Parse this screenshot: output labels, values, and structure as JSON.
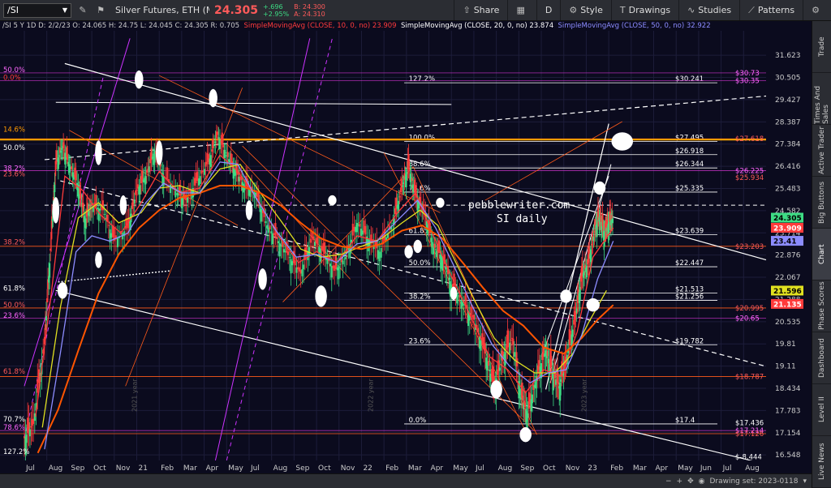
{
  "toolbar": {
    "symbol": "/SI",
    "instrument": "Silver Futures, ETH (MAR 23)",
    "last": "24.305",
    "change": "+.696",
    "change_pct": "+2.95%",
    "bid": "B: 24.300",
    "ask": "A: 24.310",
    "share": "Share",
    "period": "D",
    "style": "Style",
    "drawings": "Drawings",
    "studies": "Studies",
    "patterns": "Patterns"
  },
  "study_line": {
    "header": "/SI 5 Y 1D  D: 2/2/23  O: 24.065  H: 24.75  L: 24.045  C: 24.305  R: 0.705",
    "sma10": "SimpleMovingAvg (CLOSE, 10, 0, no)",
    "sma10_val": "23.909",
    "sma20": "SimpleMovingAvg (CLOSE, 20, 0, no)",
    "sma20_val": "23.874",
    "sma50": "SimpleMovingAvg (CLOSE, 50, 0, no)",
    "sma50_val": "32.922"
  },
  "side_tabs": [
    "Trade",
    "Times And Sales",
    "Active Trader",
    "Big Buttons",
    "Chart",
    "Phase Scores",
    "Dashboard",
    "Level II",
    "Live News"
  ],
  "bottom_bar": {
    "drawing_set": "Drawing set: 2023-0118"
  },
  "colors": {
    "background": "#0b0b1e",
    "price_up": "#3ddc84",
    "price_down": "#ff3b3b",
    "sma10": "#ff3b3b",
    "sma20": "#ffffff",
    "sma50": "#8c8cff",
    "sma_slow": "#ff5500",
    "sma_yellow": "#e0e020",
    "fib": "#ff9900",
    "annotation": "#ffffff"
  },
  "chart_data": {
    "type": "candlestick",
    "y_ticks": [
      "31.623",
      "30.505",
      "29.427",
      "28.387",
      "27.384",
      "26.416",
      "25.483",
      "24.582",
      "23.714",
      "22.876",
      "22.067",
      "21.288",
      "20.535",
      "19.81",
      "19.11",
      "18.434",
      "17.783",
      "17.154",
      "16.548"
    ],
    "y_range": [
      16.4,
      32.9
    ],
    "y_scale": "log",
    "x_labels": [
      "Jul",
      "Aug",
      "Sep",
      "Oct",
      "Nov",
      "21",
      "Feb",
      "Mar",
      "Apr",
      "May",
      "Jul",
      "Aug",
      "Sep",
      "Oct",
      "Nov",
      "22",
      "Feb",
      "Mar",
      "Apr",
      "May",
      "Jul",
      "Aug",
      "Sep",
      "Oct",
      "Nov",
      "23",
      "Feb",
      "Mar",
      "Apr",
      "May",
      "Jun",
      "Jul",
      "Aug"
    ],
    "year_markers": [
      "2021 year",
      "2022 year",
      "2023 year"
    ],
    "right_price_labels": [
      {
        "text": "$30.73",
        "price": 30.73,
        "color": "#ff66ff"
      },
      {
        "text": "$30.35",
        "price": 30.35,
        "color": "#ff66ff"
      },
      {
        "text": "$27.618",
        "price": 27.618,
        "color": "#ff5a5a"
      },
      {
        "text": "$26.225",
        "price": 26.225,
        "color": "#ff66ff"
      },
      {
        "text": "$25.934",
        "price": 25.934,
        "color": "#ff5a5a"
      },
      {
        "text": "$23.203",
        "price": 23.203,
        "color": "#ff5a5a"
      },
      {
        "text": "$20.995",
        "price": 20.995,
        "color": "#ff5a5a"
      },
      {
        "text": "$20.65",
        "price": 20.65,
        "color": "#ff66ff"
      },
      {
        "text": "$18.787",
        "price": 18.787,
        "color": "#ff5a5a"
      },
      {
        "text": "$17.436",
        "price": 17.436,
        "color": "#ffffff"
      },
      {
        "text": "$17.214",
        "price": 17.214,
        "color": "#ff66ff"
      },
      {
        "text": "$17.126",
        "price": 17.126,
        "color": "#ff5a5a"
      },
      {
        "text": "$-8.444",
        "price": 16.5,
        "color": "#ffffff"
      }
    ],
    "price_badges": [
      {
        "text": "24.305",
        "price": 24.305,
        "bg": "#3ddc84",
        "fg": "#000"
      },
      {
        "text": "23.909",
        "price": 23.909,
        "bg": "#ff3b3b",
        "fg": "#fff"
      },
      {
        "text": "23.41",
        "price": 23.41,
        "bg": "#8c8cff",
        "fg": "#000"
      },
      {
        "text": "21.596",
        "price": 21.596,
        "bg": "#e0e020",
        "fg": "#000"
      },
      {
        "text": "21.135",
        "price": 21.135,
        "bg": "#ff3b3b",
        "fg": "#fff"
      }
    ],
    "left_fib_labels": [
      {
        "text": "50.0%",
        "price": 30.73,
        "color": "#ff66ff"
      },
      {
        "text": "0.0%",
        "price": 30.35,
        "color": "#ff3b3b"
      },
      {
        "text": "14.6%",
        "price": 27.9,
        "color": "#ff9900"
      },
      {
        "text": "50.0%",
        "price": 27.08,
        "color": "#ffffff"
      },
      {
        "text": "38.2%",
        "price": 26.2,
        "color": "#ff66ff"
      },
      {
        "text": "23.6%",
        "price": 25.95,
        "color": "#ff5a5a"
      },
      {
        "text": "38.2%",
        "price": 23.25,
        "color": "#ff5a5a"
      },
      {
        "text": "61.8%",
        "price": 21.56,
        "color": "#ffffff"
      },
      {
        "text": "50.0%",
        "price": 21.0,
        "color": "#ff5a5a"
      },
      {
        "text": "23.6%",
        "price": 20.64,
        "color": "#ff66ff"
      },
      {
        "text": "61.8%",
        "price": 18.85,
        "color": "#ff5a5a"
      },
      {
        "text": "70.7%",
        "price": 17.45,
        "color": "#ffffff"
      },
      {
        "text": "78.6%",
        "price": 17.22,
        "color": "#ff66ff"
      },
      {
        "text": "127.2%",
        "price": 16.55,
        "color": "#ffffff"
      }
    ],
    "fib_levels": [
      {
        "pct": "127.2%",
        "value": "$30.241",
        "price": 30.241
      },
      {
        "pct": "100.0%",
        "value": "$27.495",
        "price": 27.495
      },
      {
        "pct": "",
        "value": "$26.918",
        "price": 26.918
      },
      {
        "pct": "88.6%",
        "value": "$26.344",
        "price": 26.344
      },
      {
        "pct": "78.6%",
        "value": "$25.335",
        "price": 25.335
      },
      {
        "pct": "61.8%",
        "value": "$23.639",
        "price": 23.639
      },
      {
        "pct": "50.0%",
        "value": "$22.447",
        "price": 22.447
      },
      {
        "pct": "",
        "value": "$21.513",
        "price": 21.513
      },
      {
        "pct": "38.2%",
        "value": "$21.256",
        "price": 21.256
      },
      {
        "pct": "23.6%",
        "value": "$19.782",
        "price": 19.782
      },
      {
        "pct": "0.0%",
        "value": "$17.4",
        "price": 17.4
      }
    ],
    "annotations": [
      "pebblewriter.com",
      "SI daily"
    ],
    "series": [
      {
        "name": "close",
        "color": "#3ddc84",
        "points": [
          [
            0,
            17.0
          ],
          [
            0.4,
            17.4
          ],
          [
            0.9,
            19.8
          ],
          [
            1.2,
            23.5
          ],
          [
            1.4,
            26.5
          ],
          [
            1.7,
            27.3
          ],
          [
            2.0,
            26.5
          ],
          [
            2.4,
            25.6
          ],
          [
            2.7,
            24.2
          ],
          [
            3.0,
            24.8
          ],
          [
            3.5,
            24.6
          ],
          [
            4.0,
            23.4
          ],
          [
            4.6,
            23.9
          ],
          [
            5.0,
            25.4
          ],
          [
            5.4,
            26.0
          ],
          [
            5.8,
            27.1
          ],
          [
            6.2,
            26.0
          ],
          [
            6.8,
            25.3
          ],
          [
            7.2,
            25.0
          ],
          [
            7.7,
            25.8
          ],
          [
            8.2,
            26.6
          ],
          [
            8.6,
            27.8
          ],
          [
            9.0,
            26.9
          ],
          [
            9.4,
            26.2
          ],
          [
            9.8,
            25.6
          ],
          [
            10.3,
            25.3
          ],
          [
            10.8,
            24.0
          ],
          [
            11.3,
            23.4
          ],
          [
            11.8,
            22.8
          ],
          [
            12.3,
            22.2
          ],
          [
            12.8,
            23.5
          ],
          [
            13.3,
            23.0
          ],
          [
            13.8,
            22.3
          ],
          [
            14.3,
            22.8
          ],
          [
            14.8,
            24.1
          ],
          [
            15.3,
            23.5
          ],
          [
            15.8,
            23.0
          ],
          [
            16.4,
            24.1
          ],
          [
            16.8,
            25.5
          ],
          [
            17.1,
            26.4
          ],
          [
            17.4,
            25.2
          ],
          [
            17.8,
            24.5
          ],
          [
            18.2,
            23.2
          ],
          [
            18.6,
            22.8
          ],
          [
            19.0,
            21.8
          ],
          [
            19.5,
            21.2
          ],
          [
            20.0,
            20.6
          ],
          [
            20.5,
            19.5
          ],
          [
            20.9,
            18.5
          ],
          [
            21.3,
            19.4
          ],
          [
            21.7,
            20.0
          ],
          [
            22.1,
            18.2
          ],
          [
            22.4,
            17.7
          ],
          [
            22.8,
            18.8
          ],
          [
            23.2,
            19.6
          ],
          [
            23.5,
            18.9
          ],
          [
            23.8,
            18.5
          ],
          [
            24.1,
            19.3
          ],
          [
            24.5,
            20.6
          ],
          [
            24.8,
            22.1
          ],
          [
            25.1,
            22.6
          ],
          [
            25.4,
            23.9
          ],
          [
            25.6,
            24.4
          ],
          [
            25.8,
            23.7
          ],
          [
            26.0,
            24.1
          ],
          [
            26.2,
            24.3
          ]
        ]
      },
      {
        "name": "SMA 10",
        "color": "#ff3b3b",
        "points": [
          [
            0.5,
            17.6
          ],
          [
            1.2,
            21.5
          ],
          [
            1.8,
            26.0
          ],
          [
            2.6,
            25.4
          ],
          [
            3.4,
            24.4
          ],
          [
            4.3,
            23.7
          ],
          [
            5.2,
            24.9
          ],
          [
            6.0,
            26.2
          ],
          [
            6.9,
            25.3
          ],
          [
            7.8,
            25.5
          ],
          [
            8.7,
            26.9
          ],
          [
            9.5,
            26.2
          ],
          [
            10.4,
            25.0
          ],
          [
            11.3,
            23.6
          ],
          [
            12.2,
            22.6
          ],
          [
            13.0,
            23.0
          ],
          [
            13.9,
            22.6
          ],
          [
            14.8,
            23.6
          ],
          [
            15.7,
            23.4
          ],
          [
            16.6,
            24.5
          ],
          [
            17.4,
            25.3
          ],
          [
            18.2,
            23.6
          ],
          [
            19.0,
            22.1
          ],
          [
            19.8,
            20.8
          ],
          [
            20.7,
            19.4
          ],
          [
            21.5,
            19.0
          ],
          [
            22.3,
            18.3
          ],
          [
            23.1,
            19.0
          ],
          [
            23.9,
            18.8
          ],
          [
            24.6,
            20.2
          ],
          [
            25.3,
            22.8
          ],
          [
            26.2,
            23.9
          ]
        ]
      },
      {
        "name": "SMA 20",
        "color": "#e0e020",
        "points": [
          [
            0.8,
            17.3
          ],
          [
            1.6,
            21.0
          ],
          [
            2.4,
            24.3
          ],
          [
            3.3,
            24.9
          ],
          [
            4.2,
            24.1
          ],
          [
            5.2,
            24.5
          ],
          [
            6.0,
            25.5
          ],
          [
            6.9,
            25.6
          ],
          [
            7.8,
            25.3
          ],
          [
            8.7,
            26.3
          ],
          [
            9.6,
            26.5
          ],
          [
            10.5,
            25.3
          ],
          [
            11.4,
            24.2
          ],
          [
            12.3,
            23.1
          ],
          [
            13.2,
            22.8
          ],
          [
            14.1,
            22.9
          ],
          [
            15.0,
            23.2
          ],
          [
            15.9,
            23.5
          ],
          [
            16.8,
            24.1
          ],
          [
            17.6,
            24.6
          ],
          [
            18.4,
            24.0
          ],
          [
            19.2,
            22.6
          ],
          [
            20.0,
            21.3
          ],
          [
            20.9,
            20.0
          ],
          [
            21.8,
            19.3
          ],
          [
            22.7,
            18.9
          ],
          [
            23.6,
            18.9
          ],
          [
            24.4,
            19.5
          ],
          [
            25.1,
            20.5
          ],
          [
            25.9,
            21.6
          ]
        ]
      },
      {
        "name": "SMA 50",
        "color": "#ff5500",
        "points": [
          [
            0.6,
            16.6
          ],
          [
            1.5,
            17.8
          ],
          [
            2.4,
            19.6
          ],
          [
            3.3,
            21.5
          ],
          [
            4.2,
            22.9
          ],
          [
            5.1,
            23.9
          ],
          [
            6.0,
            24.6
          ],
          [
            6.9,
            25.1
          ],
          [
            7.8,
            25.3
          ],
          [
            8.7,
            25.6
          ],
          [
            9.6,
            25.6
          ],
          [
            10.5,
            25.3
          ],
          [
            11.4,
            24.8
          ],
          [
            12.3,
            24.1
          ],
          [
            13.2,
            23.5
          ],
          [
            14.1,
            23.2
          ],
          [
            15.0,
            23.1
          ],
          [
            15.9,
            23.3
          ],
          [
            16.8,
            23.8
          ],
          [
            17.7,
            24.0
          ],
          [
            18.6,
            23.5
          ],
          [
            19.5,
            22.6
          ],
          [
            20.4,
            21.7
          ],
          [
            21.3,
            20.9
          ],
          [
            22.2,
            20.4
          ],
          [
            23.1,
            19.7
          ],
          [
            24.0,
            19.5
          ],
          [
            24.8,
            20.0
          ],
          [
            25.5,
            20.6
          ],
          [
            26.2,
            21.1
          ]
        ]
      },
      {
        "name": "SMA slow",
        "color": "#8c8cff",
        "points": [
          [
            0.9,
            16.7
          ],
          [
            1.6,
            19.5
          ],
          [
            2.3,
            23.0
          ],
          [
            3.0,
            23.6
          ],
          [
            3.8,
            23.4
          ],
          [
            4.6,
            23.7
          ],
          [
            5.4,
            24.9
          ],
          [
            6.2,
            25.7
          ],
          [
            7.0,
            25.3
          ],
          [
            7.8,
            25.3
          ],
          [
            8.7,
            26.6
          ],
          [
            9.5,
            26.5
          ],
          [
            10.3,
            25.1
          ],
          [
            11.2,
            23.8
          ],
          [
            12.1,
            22.8
          ],
          [
            13.0,
            22.9
          ],
          [
            13.9,
            22.6
          ],
          [
            14.8,
            23.3
          ],
          [
            15.7,
            23.4
          ],
          [
            16.6,
            24.2
          ],
          [
            17.5,
            25.0
          ],
          [
            18.3,
            23.9
          ],
          [
            19.1,
            22.5
          ],
          [
            19.9,
            21.1
          ],
          [
            20.8,
            19.8
          ],
          [
            21.6,
            19.1
          ],
          [
            22.5,
            18.6
          ],
          [
            23.3,
            18.9
          ],
          [
            24.1,
            19.0
          ],
          [
            24.8,
            20.1
          ],
          [
            25.5,
            22.0
          ],
          [
            26.2,
            23.4
          ]
        ]
      }
    ]
  }
}
